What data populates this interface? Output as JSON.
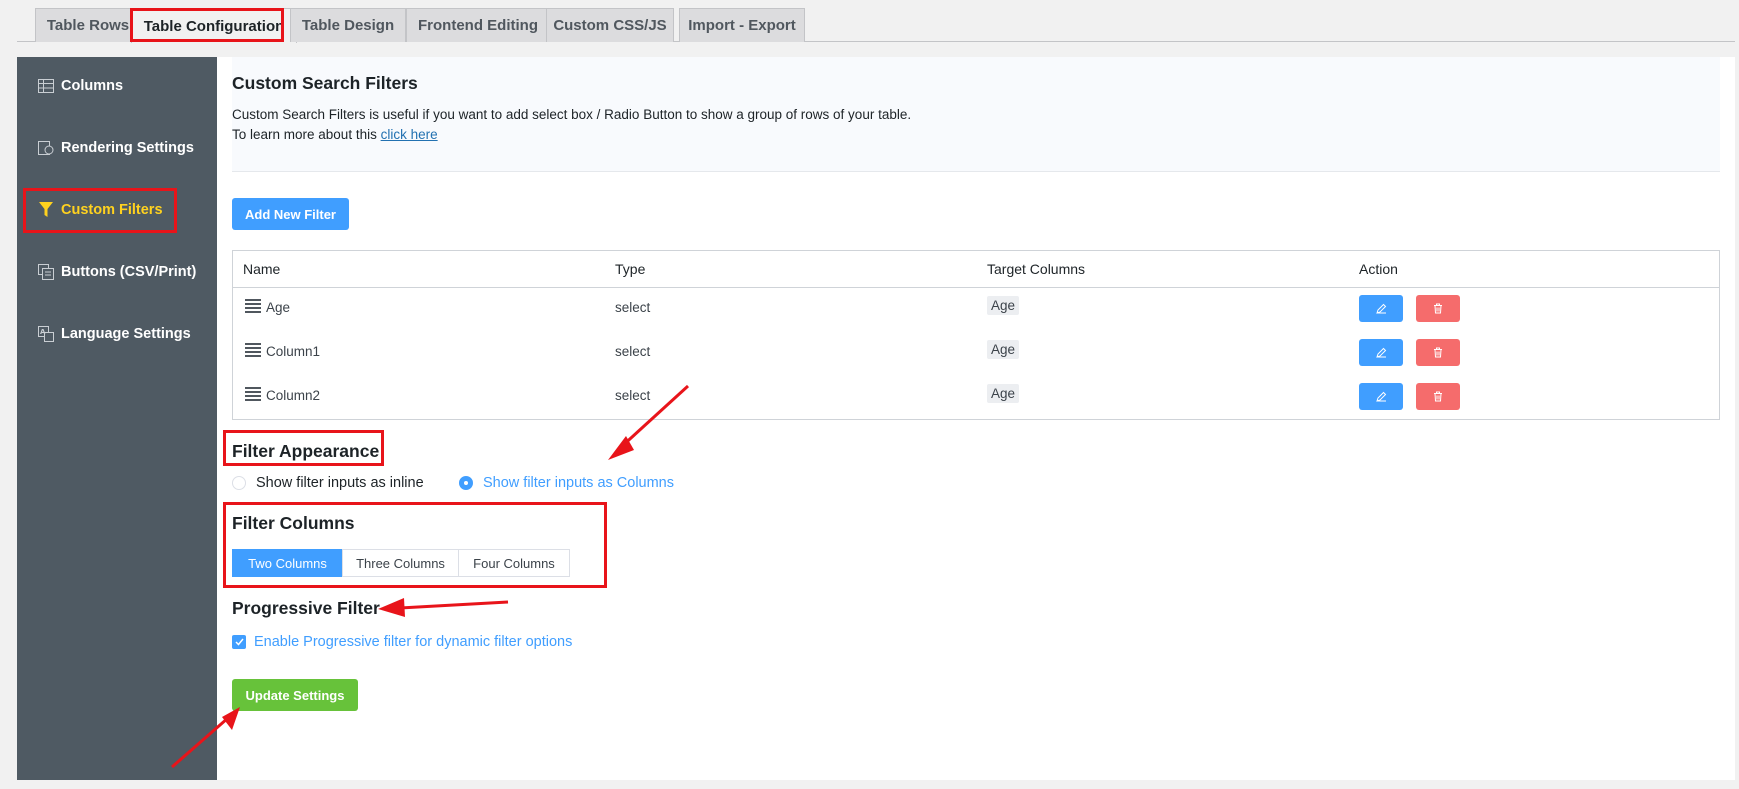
{
  "tabs": [
    {
      "label": "Table Rows"
    },
    {
      "label": "Table Configuration"
    },
    {
      "label": "Table Design"
    },
    {
      "label": "Frontend Editing"
    },
    {
      "label": "Custom CSS/JS"
    },
    {
      "label": "Import - Export"
    }
  ],
  "sidebar": {
    "items": [
      {
        "label": "Columns",
        "icon": "table-icon"
      },
      {
        "label": "Rendering Settings",
        "icon": "rendering-icon"
      },
      {
        "label": "Custom Filters",
        "icon": "filter-icon"
      },
      {
        "label": "Buttons (CSV/Print)",
        "icon": "buttons-icon"
      },
      {
        "label": "Language Settings",
        "icon": "language-icon"
      }
    ],
    "active_color": "#ffd21f"
  },
  "info": {
    "title": "Custom Search Filters",
    "line1": "Custom Search Filters is useful if you want to add select box / Radio Button to show a group of rows of your table.",
    "line2_prefix": "To learn more about this",
    "line2_link": "click here"
  },
  "add_filter_label": "Add New Filter",
  "table": {
    "headers": [
      "Name",
      "Type",
      "Target Columns",
      "Action"
    ],
    "rows": [
      {
        "name": "Age",
        "type": "select",
        "target": "Age"
      },
      {
        "name": "Column1",
        "type": "select",
        "target": "Age"
      },
      {
        "name": "Column2",
        "type": "select",
        "target": "Age"
      }
    ]
  },
  "appearance": {
    "title": "Filter Appearance",
    "options": [
      "Show filter inputs as inline",
      "Show filter inputs as Columns"
    ],
    "selected": "Show filter inputs as Columns"
  },
  "columns": {
    "title": "Filter Columns",
    "options": [
      "Two Columns",
      "Three Columns",
      "Four Columns"
    ],
    "selected": "Two Columns"
  },
  "progressive": {
    "title": "Progressive Filter",
    "checkbox_label": "Enable Progressive filter for dynamic filter options",
    "checked": true
  },
  "update_label": "Update Settings",
  "colors": {
    "primary": "#409eff",
    "danger": "#f56c6c",
    "success": "#67c23a",
    "annotation": "#e8141a",
    "sidebar": "#4f5a63"
  }
}
